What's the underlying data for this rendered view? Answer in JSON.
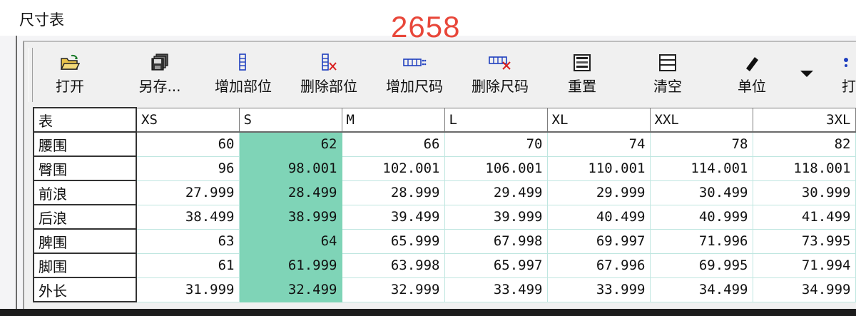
{
  "window": {
    "title": "尺寸表",
    "overlay_number": "2658"
  },
  "toolbar": {
    "items": [
      {
        "label": "打开",
        "icon": "open-folder-icon"
      },
      {
        "label": "另存...",
        "icon": "save-as-icon"
      },
      {
        "label": "增加部位",
        "icon": "add-row-icon"
      },
      {
        "label": "删除部位",
        "icon": "delete-row-icon"
      },
      {
        "label": "增加尺码",
        "icon": "add-column-icon"
      },
      {
        "label": "删除尺码",
        "icon": "delete-column-icon"
      },
      {
        "label": "重置",
        "icon": "reset-icon"
      },
      {
        "label": "清空",
        "icon": "clear-icon"
      },
      {
        "label": "单位",
        "icon": "unit-icon"
      },
      {
        "label": "打",
        "icon": "print-icon"
      }
    ],
    "colors": {
      "icon_blue": "#1f3fbf",
      "icon_red": "#d92020",
      "icon_dark": "#222222",
      "folder_yellow": "#e8c34a"
    }
  },
  "table": {
    "corner_label": "表",
    "columns": [
      "XS",
      "S",
      "M",
      "L",
      "XL",
      "XXL",
      "3XL"
    ],
    "selected_column_index": 1,
    "selection_color": "#7fd4b7",
    "rows": [
      {
        "label": "腰围",
        "values": [
          "60",
          "62",
          "66",
          "70",
          "74",
          "78",
          "82"
        ]
      },
      {
        "label": "臀围",
        "values": [
          "96",
          "98.001",
          "102.001",
          "106.001",
          "110.001",
          "114.001",
          "118.001"
        ]
      },
      {
        "label": "前浪",
        "values": [
          "27.999",
          "28.499",
          "28.999",
          "29.499",
          "29.999",
          "30.499",
          "30.999"
        ]
      },
      {
        "label": "后浪",
        "values": [
          "38.499",
          "38.999",
          "39.499",
          "39.999",
          "40.499",
          "40.999",
          "41.499"
        ]
      },
      {
        "label": "脾围",
        "values": [
          "63",
          "64",
          "65.999",
          "67.998",
          "69.997",
          "71.996",
          "73.995"
        ]
      },
      {
        "label": "脚围",
        "values": [
          "61",
          "61.999",
          "63.998",
          "65.997",
          "67.996",
          "69.995",
          "71.994"
        ]
      },
      {
        "label": "外长",
        "values": [
          "31.999",
          "32.499",
          "32.999",
          "33.499",
          "33.999",
          "34.499",
          "34.999"
        ]
      }
    ]
  }
}
